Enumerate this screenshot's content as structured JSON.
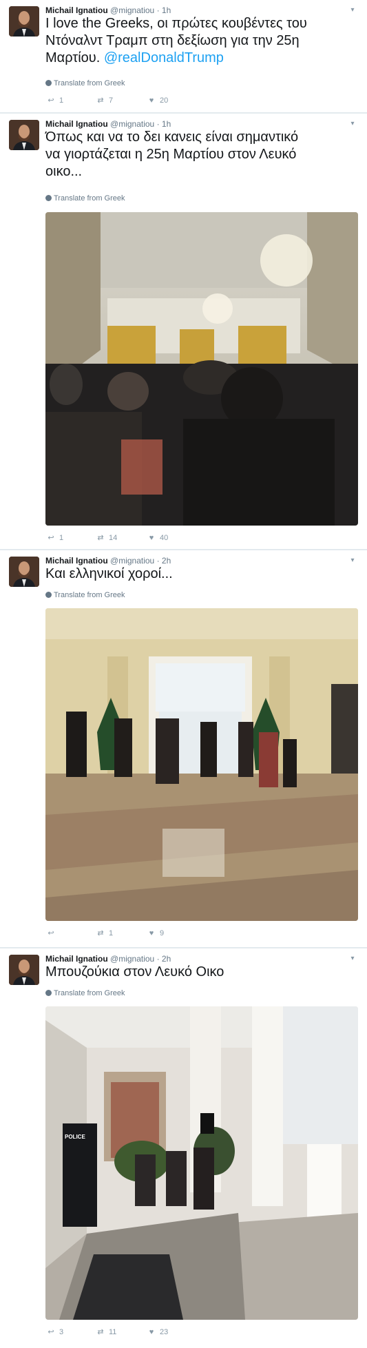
{
  "tweets": [
    {
      "author": "Michail Ignatiou",
      "handle": "@mignatiou",
      "time": "1h",
      "text_lines": [
        "I love the Greeks, οι πρώτες κουβέντες του",
        "Ντόναλντ Τραμπ στη δεξίωση για την 25η",
        "Μαρτίου."
      ],
      "mention": "@realDonaldTrump",
      "translate": "Translate from Greek",
      "stats": {
        "replies": "1",
        "retweets": "7",
        "likes": "20"
      }
    },
    {
      "author": "Michail Ignatiou",
      "handle": "@mignatiou",
      "time": "1h",
      "text_lines": [
        "Όπως και να το δει κανεις είναι σημαντικό",
        "να γιορτάζεται η 25η Μαρτίου στον Λευκό",
        "οικο..."
      ],
      "translate": "Translate from Greek",
      "stats": {
        "replies": "1",
        "retweets": "14",
        "likes": "40"
      }
    },
    {
      "author": "Michail Ignatiou",
      "handle": "@mignatiou",
      "time": "2h",
      "text_lines": [
        "Και ελληνικοί χοροί..."
      ],
      "translate": "Translate from Greek",
      "stats": {
        "replies": "",
        "retweets": "1",
        "likes": "9"
      }
    },
    {
      "author": "Michail Ignatiou",
      "handle": "@mignatiou",
      "time": "2h",
      "text_lines": [
        "Μπουζούκια στον Λευκό Οικο"
      ],
      "translate": "Translate from Greek",
      "stats": {
        "replies": "3",
        "retweets": "11",
        "likes": "23"
      },
      "photo_sign": "POLICE"
    }
  ],
  "separator": "·",
  "icons": [
    "avatar-photo",
    "chevron-down-icon",
    "globe-icon",
    "reply-icon",
    "retweet-icon",
    "heart-icon"
  ],
  "colors": {
    "link": "#1da1f2",
    "muted": "#657786",
    "background": "#e6ecf0"
  }
}
